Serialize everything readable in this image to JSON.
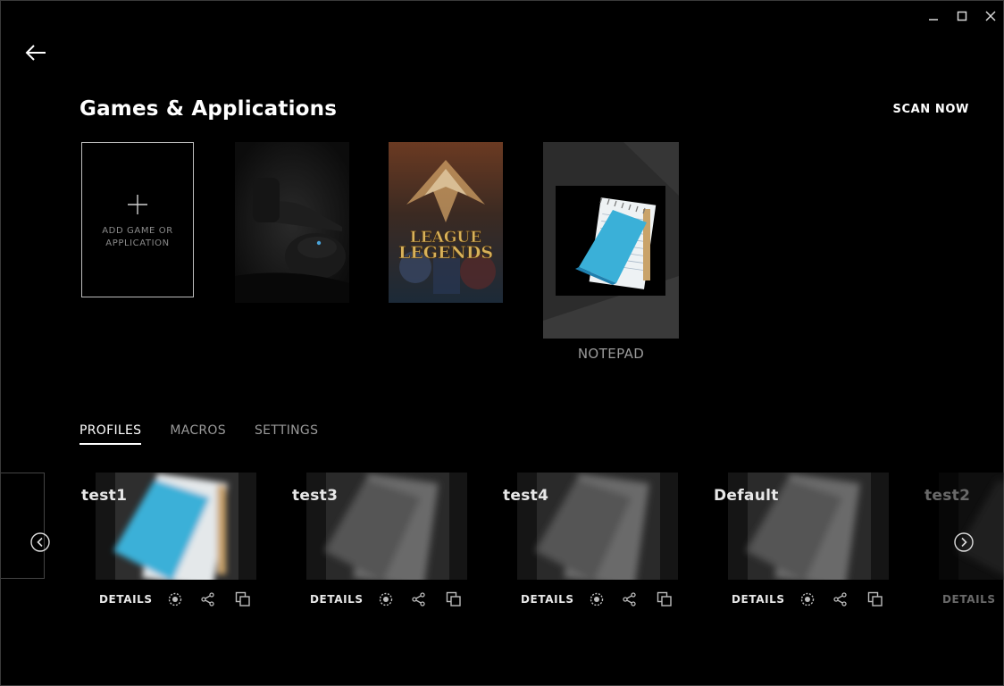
{
  "window": {
    "minimize_icon": "minimize-icon",
    "maximize_icon": "maximize-icon",
    "close_icon": "close-icon"
  },
  "header": {
    "back_icon": "arrow-left-icon",
    "title": "Games & Applications",
    "scan_now": "SCAN NOW"
  },
  "games": {
    "add_tile_label": "ADD GAME OR APPLICATION",
    "tiles": [
      {
        "name": "mouse-artwork",
        "caption": ""
      },
      {
        "name": "league-of-legends",
        "artwork_text": [
          "LEAGUE",
          "LEGENDS"
        ],
        "caption": ""
      },
      {
        "name": "notepad",
        "caption": "NOTEPAD"
      }
    ]
  },
  "tabs": [
    "PROFILES",
    "MACROS",
    "SETTINGS"
  ],
  "active_tab": "PROFILES",
  "profiles": [
    {
      "name": "test1",
      "details": "DETAILS",
      "active": true
    },
    {
      "name": "test3",
      "details": "DETAILS",
      "active": false
    },
    {
      "name": "test4",
      "details": "DETAILS",
      "active": false
    },
    {
      "name": "Default",
      "details": "DETAILS",
      "active": false
    },
    {
      "name": "test2",
      "details": "DETAILS",
      "active": false
    }
  ],
  "profile_actions": [
    "persistent-profile-icon",
    "share-icon",
    "copy-icon"
  ],
  "colors": {
    "background": "#000000",
    "text_primary": "#ffffff",
    "text_secondary": "#9a9a9a",
    "notepad_blue": "#3ab0d8"
  }
}
